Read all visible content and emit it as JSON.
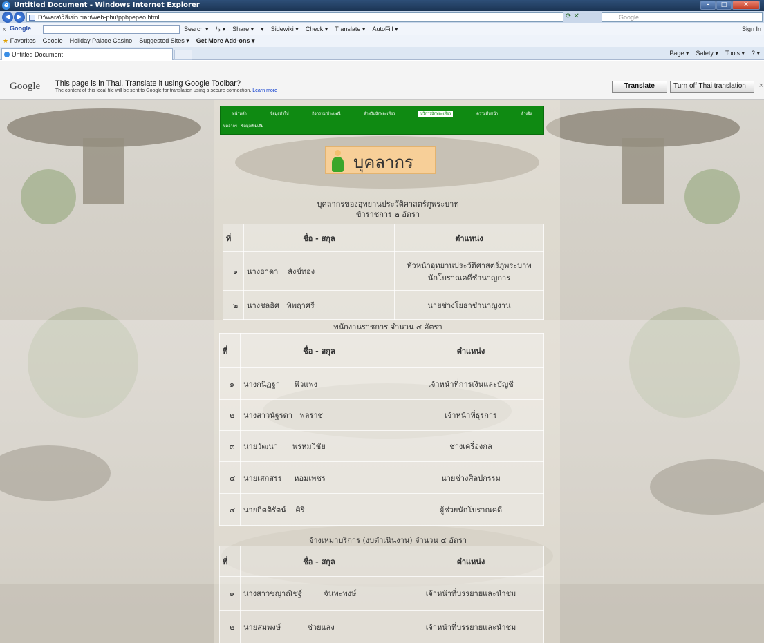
{
  "browser": {
    "window_title": "Untitled Document - Windows Internet Explorer",
    "address": "D:\\wara\\วิธีเข้า ฯลฯ\\web-phu\\ppbpepeo.html",
    "search_placeholder": "Google",
    "window_buttons": [
      "–",
      "□",
      "✕"
    ]
  },
  "google_toolbar": {
    "close": "x",
    "logo": "Google",
    "items": [
      "Search ▾",
      "⇆ ▾",
      "Share ▾",
      "▾",
      "Sidewiki ▾",
      "Check ▾",
      "Translate ▾",
      "AutoFill ▾"
    ],
    "sign_in": "Sign In"
  },
  "favorites_bar": {
    "items": [
      "Favorites",
      "Google",
      "Holiday Palace Casino",
      "Suggested Sites ▾",
      "Get More Add-ons ▾"
    ]
  },
  "tabs": {
    "active": "Untitled Document",
    "commands": [
      "Page ▾",
      "Safety ▾",
      "Tools ▾",
      "? ▾"
    ]
  },
  "translate_bar": {
    "logo": "Google",
    "message": "This page is in Thai.  Translate it using Google Toolbar?",
    "sub_message": "The content of this local file will be sent to Google for translation using a secure connection.",
    "learn_more": "Learn more",
    "translate_button": "Translate",
    "turn_off_button": "Turn off Thai translation",
    "close": "×"
  },
  "site_menu": {
    "row1": [
      "หน้าหลัก",
      "ข้อมูลทั่วไป",
      "กิจกรรม/ประเพณี",
      "สำหรับนักท่องเที่ยว",
      "บริการนักท่องเที่ยว",
      "ความคืบหน้า",
      "อ้างอิง"
    ],
    "active_index": 4,
    "row2": [
      "บุคลากร",
      "ข้อมูลเพิ่มเติม"
    ]
  },
  "page_title": "บุคลากร",
  "section1": {
    "heading_line1": "บุคลากรของอุทยานประวัติศาสตร์ภูพระบาท",
    "heading_line2": "ข้าราชการ ๒ อัตรา",
    "headers": [
      "ที่",
      "ชื่อ - สกุล",
      "ตำแหน่ง"
    ],
    "rows": [
      {
        "no": "๑",
        "first": "นางธาดา",
        "last": "สังข์ทอง",
        "pos1": "หัวหน้าอุทยานประวัติศาสตร์ภูพระบาท",
        "pos2": "นักโบราณคดีชำนาญการ"
      },
      {
        "no": "๒",
        "first": "นางชลธิศ",
        "last": "ทิพฤาศรี",
        "pos1": "นายช่างโยธาชำนาญงาน",
        "pos2": ""
      }
    ]
  },
  "section2": {
    "heading": "พนักงานราชการ  จำนวน ๔ อัตรา",
    "headers": [
      "ที่",
      "ชื่อ - สกุล",
      "ตำแหน่ง"
    ],
    "rows": [
      {
        "no": "๑",
        "first": "นางกนิฏฐา",
        "last": "พิวแพง",
        "pos": "เจ้าหน้าที่การเงินและบัญชี"
      },
      {
        "no": "๒",
        "first": "นางสาวนัฐรดา",
        "last": "พลราช",
        "pos": "เจ้าหน้าที่ธุรการ"
      },
      {
        "no": "๓",
        "first": "นายวัฒนา",
        "last": "พรหมวิชัย",
        "pos": "ช่างเครื่องกล"
      },
      {
        "no": "๔",
        "first": "นายเสกสรร",
        "last": "หอมเพชร",
        "pos": "นายช่างศิลปกรรม"
      },
      {
        "no": "๔",
        "first": "นายกิตติรัตน์",
        "last": "ศิริ",
        "pos": "ผู้ช่วยนักโบราณคดี"
      }
    ]
  },
  "section3": {
    "heading": "จ้างเหมาบริการ (งบดำเนินงาน) จำนวน ๔ อัตรา",
    "headers": [
      "ที่",
      "ชื่อ - สกุล",
      "ตำแหน่ง"
    ],
    "rows": [
      {
        "no": "๑",
        "first": "นางสาวชญาณิชฐ์",
        "last": "จันทะพงษ์",
        "pos": "เจ้าหน้าที่บรรยายและนำชม"
      },
      {
        "no": "๒",
        "first": "นายสมพงษ์",
        "last": "ช่วยแสง",
        "pos": "เจ้าหน้าที่บรรยายและนำชม"
      }
    ]
  }
}
